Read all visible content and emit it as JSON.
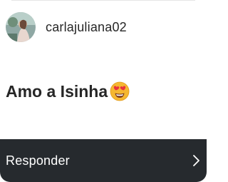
{
  "header": {
    "username": "carlajuliana02",
    "avatar_icon": "profile-photo"
  },
  "message": {
    "text": "Amo a Isinha",
    "emoji_icon": "heart-eyes-emoji"
  },
  "reply_bar": {
    "label": "Responder",
    "chevron_icon": "chevron-right-icon",
    "background": "#262a2e"
  }
}
